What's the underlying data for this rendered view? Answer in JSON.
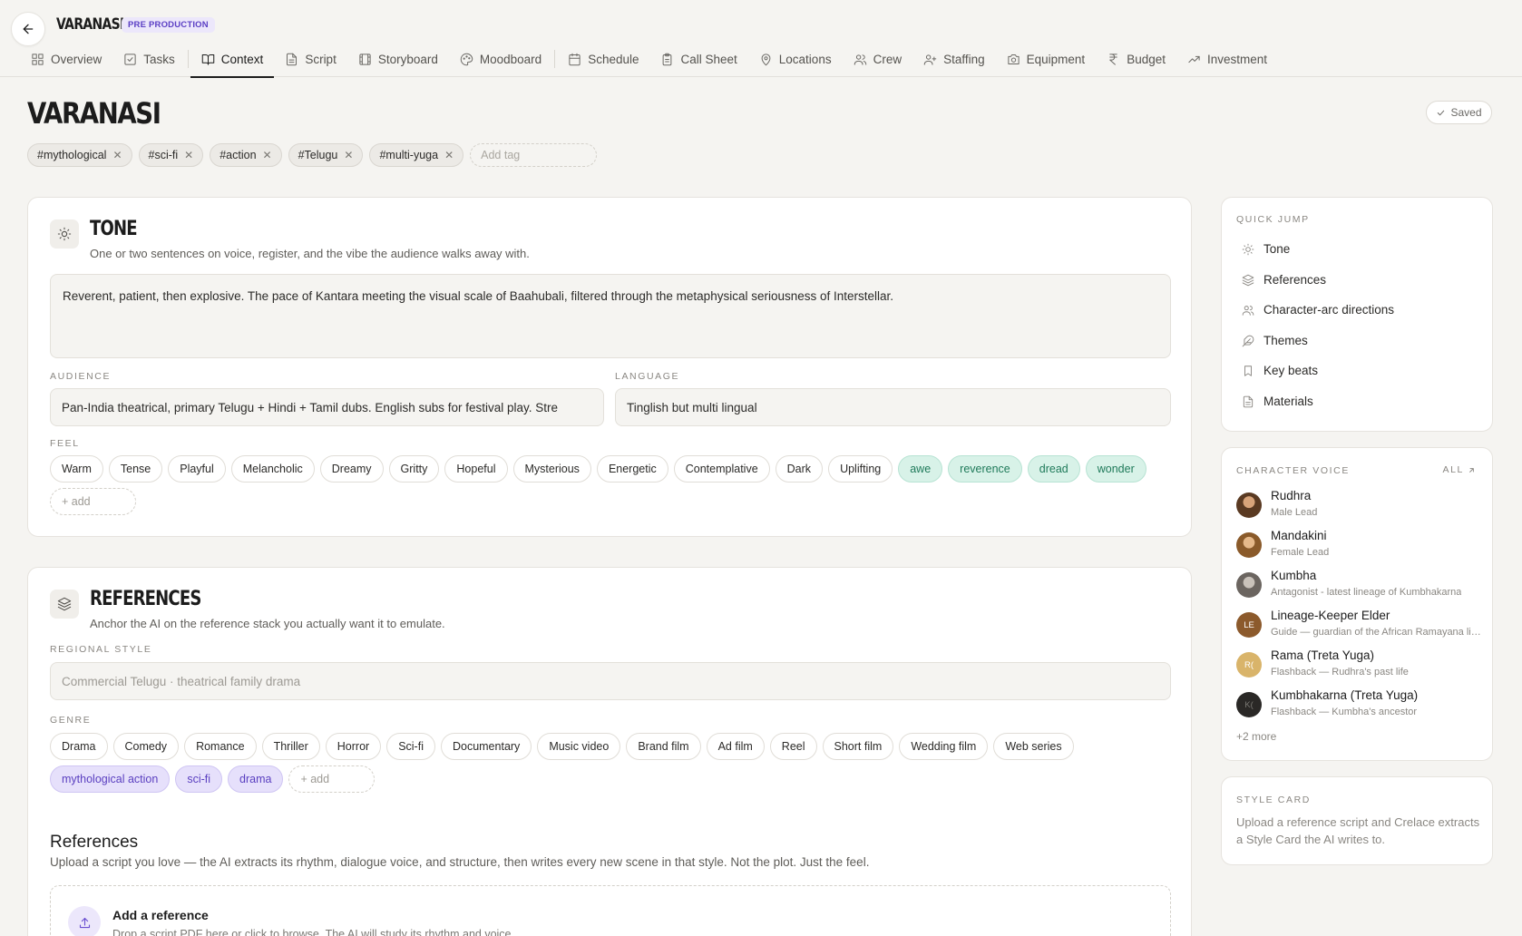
{
  "header": {
    "project_title": "VARANASI",
    "phase_badge": "PRE PRODUCTION",
    "tabs": [
      {
        "label": "Overview",
        "icon": "grid-icon"
      },
      {
        "label": "Tasks",
        "icon": "checkbox-icon"
      },
      {
        "label": "Context",
        "icon": "book-icon",
        "active": true
      },
      {
        "label": "Script",
        "icon": "document-icon"
      },
      {
        "label": "Storyboard",
        "icon": "film-icon"
      },
      {
        "label": "Moodboard",
        "icon": "palette-icon"
      },
      {
        "label": "Schedule",
        "icon": "calendar-icon"
      },
      {
        "label": "Call Sheet",
        "icon": "clipboard-icon"
      },
      {
        "label": "Locations",
        "icon": "map-pin-icon"
      },
      {
        "label": "Crew",
        "icon": "users-icon"
      },
      {
        "label": "Staffing",
        "icon": "user-plus-icon"
      },
      {
        "label": "Equipment",
        "icon": "camera-icon"
      },
      {
        "label": "Budget",
        "icon": "rupee-icon"
      },
      {
        "label": "Investment",
        "icon": "trending-up-icon"
      }
    ]
  },
  "page": {
    "title": "VARANASI",
    "saved_label": "Saved",
    "tags": [
      "#mythological",
      "#sci-fi",
      "#action",
      "#Telugu",
      "#multi-yuga"
    ],
    "tag_placeholder": "Add tag"
  },
  "tone": {
    "title": "TONE",
    "subtitle": "One or two sentences on voice, register, and the vibe the audience walks away with.",
    "value": "Reverent, patient, then explosive. The pace of Kantara meeting the visual scale of Baahubali, filtered through the metaphysical seriousness of Interstellar.",
    "audience_label": "AUDIENCE",
    "audience_value": "Pan-India theatrical, primary Telugu + Hindi + Tamil dubs. English subs for festival play. Stre",
    "language_label": "LANGUAGE",
    "language_value": "Tinglish but multi lingual",
    "feel_label": "FEEL",
    "feel_options": [
      "Warm",
      "Tense",
      "Playful",
      "Melancholic",
      "Dreamy",
      "Gritty",
      "Hopeful",
      "Mysterious",
      "Energetic",
      "Contemplative",
      "Dark",
      "Uplifting"
    ],
    "feel_selected": [
      "awe",
      "reverence",
      "dread",
      "wonder"
    ],
    "add_label": "+ add"
  },
  "references": {
    "title": "REFERENCES",
    "subtitle": "Anchor the AI on the reference stack you actually want it to emulate.",
    "regional_label": "REGIONAL STYLE",
    "regional_placeholder": "Commercial Telugu · theatrical family drama",
    "genre_label": "GENRE",
    "genre_options": [
      "Drama",
      "Comedy",
      "Romance",
      "Thriller",
      "Horror",
      "Sci-fi",
      "Documentary",
      "Music video",
      "Brand film",
      "Ad film",
      "Reel",
      "Short film",
      "Wedding film",
      "Web series"
    ],
    "genre_selected": [
      "mythological action",
      "sci-fi",
      "drama"
    ],
    "add_label": "+ add",
    "refs_heading": "References",
    "refs_sub": "Upload a script you love — the AI extracts its rhythm, dialogue voice, and structure, then writes every new scene in that style. Not the plot. Just the feel.",
    "add_ref_title": "Add a reference",
    "add_ref_sub": "Drop a script PDF here or click to browse. The AI will study its rhythm and voice."
  },
  "sidebar": {
    "quick_jump_label": "QUICK JUMP",
    "quick_jump": [
      {
        "label": "Tone",
        "icon": "sun-icon"
      },
      {
        "label": "References",
        "icon": "layers-icon"
      },
      {
        "label": "Character-arc directions",
        "icon": "users-icon"
      },
      {
        "label": "Themes",
        "icon": "feather-icon"
      },
      {
        "label": "Key beats",
        "icon": "bookmark-icon"
      },
      {
        "label": "Materials",
        "icon": "document-icon"
      }
    ],
    "voice_label": "CHARACTER VOICE",
    "all_label": "ALL",
    "characters": [
      {
        "name": "Rudhra",
        "role": "Male Lead",
        "initials": "",
        "color": "#5a3a22"
      },
      {
        "name": "Mandakini",
        "role": "Female Lead",
        "initials": "",
        "color": "#8a5a2a"
      },
      {
        "name": "Kumbha",
        "role": "Antagonist - latest lineage of Kumbhakarna",
        "initials": "",
        "color": "#6b6560"
      },
      {
        "name": "Lineage-Keeper Elder",
        "role": "Guide — guardian of the African Ramayana lineage",
        "initials": "LE",
        "color": "#8c5a2c"
      },
      {
        "name": "Rama (Treta Yuga)",
        "role": "Flashback — Rudhra's past life",
        "initials": "R(",
        "color": "#d9b46a"
      },
      {
        "name": "Kumbhakarna (Treta Yuga)",
        "role": "Flashback — Kumbha's ancestor",
        "initials": "K(",
        "color": "#2a2826"
      }
    ],
    "more_label": "+2 more",
    "style_label": "STYLE CARD",
    "style_text": "Upload a reference script and Crelace extracts a Style Card the AI writes to."
  }
}
